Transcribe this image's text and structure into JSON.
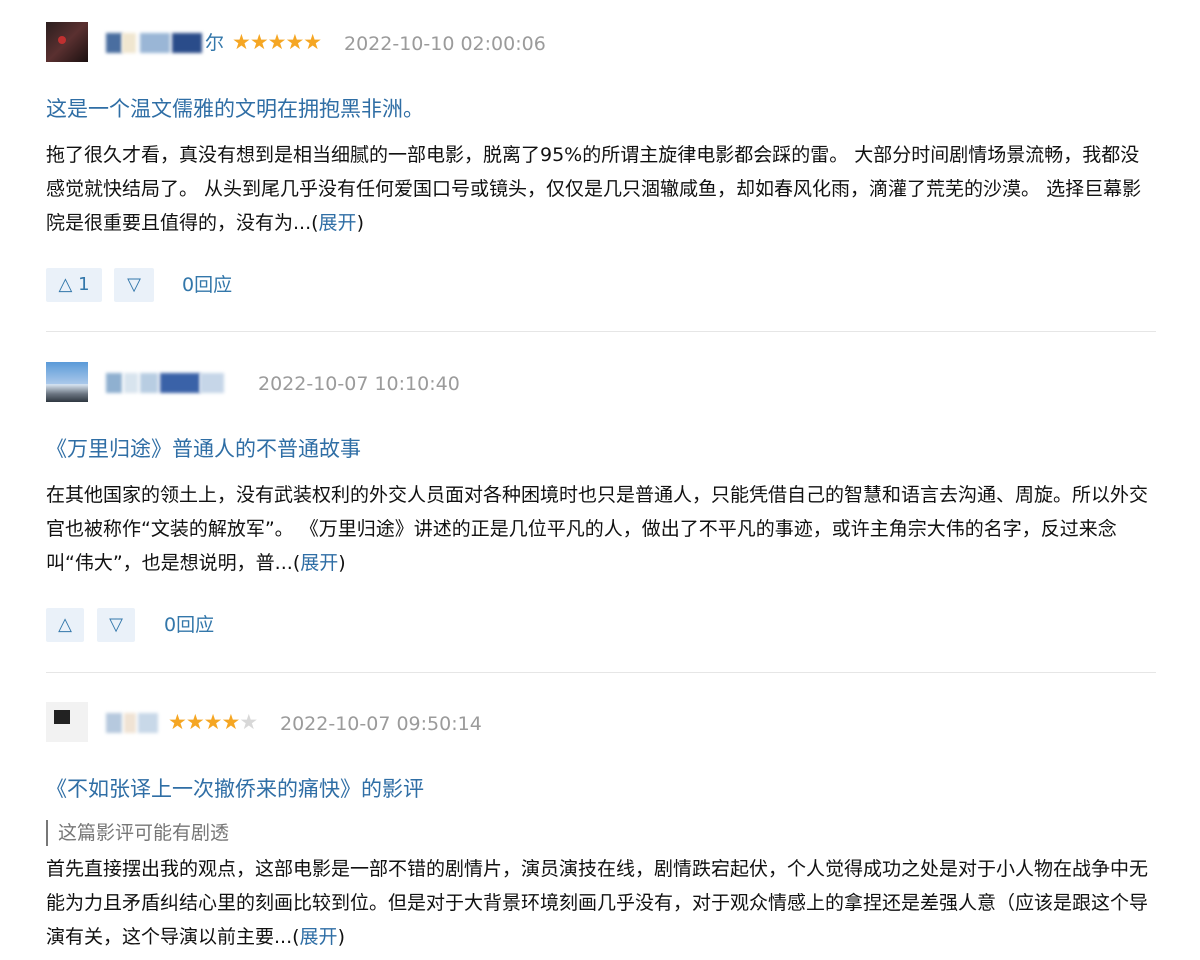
{
  "reviews": [
    {
      "username_visible": "尔",
      "stars": "★★★★★",
      "stars_off": "",
      "rating": 5,
      "date": "2022-10-10 02:00:06",
      "title": "这是一个温文儒雅的文明在拥抱黑非洲。",
      "spoiler": "",
      "body": "拖了很久才看，真没有想到是相当细腻的一部电影，脱离了95%的所谓主旋律电影都会踩的雷。 大部分时间剧情场景流畅，我都没感觉就快结局了。 从头到尾几乎没有任何爱国口号或镜头，仅仅是几只涸辙咸鱼，却如春风化雨，滴灌了荒芜的沙漠。 选择巨幕影院是很重要且值得的，没有为...",
      "expand_open": "(",
      "expand": "展开",
      "expand_close": ")",
      "up_arrow": "△",
      "up_count": "1",
      "down_arrow": "▽",
      "reply": "0回应"
    },
    {
      "username_visible": "",
      "stars": "",
      "stars_off": "",
      "rating": null,
      "date": "2022-10-07 10:10:40",
      "title": "《万里归途》普通人的不普通故事",
      "spoiler": "",
      "body": "在其他国家的领土上，没有武装权利的外交人员面对各种困境时也只是普通人，只能凭借自己的智慧和语言去沟通、周旋。所以外交官也被称作“文装的解放军”。 《万里归途》讲述的正是几位平凡的人，做出了不平凡的事迹，或许主角宗大伟的名字，反过来念叫“伟大”，也是想说明，普...",
      "expand_open": "(",
      "expand": "展开",
      "expand_close": ")",
      "up_arrow": "△",
      "up_count": "",
      "down_arrow": "▽",
      "reply": "0回应"
    },
    {
      "username_visible": "",
      "stars": "★★★★",
      "stars_off": "★",
      "rating": 4,
      "date": "2022-10-07 09:50:14",
      "title": "《不如张译上一次撤侨来的痛快》的影评",
      "spoiler": "这篇影评可能有剧透",
      "body": "首先直接摆出我的观点，这部电影是一部不错的剧情片，演员演技在线，剧情跌宕起伏，个人觉得成功之处是对于小人物在战争中无能为力且矛盾纠结心里的刻画比较到位。但是对于大背景环境刻画几乎没有，对于观众情感上的拿捏还是差强人意（应该是跟这个导演有关，这个导演以前主要...",
      "expand_open": "(",
      "expand": "展开",
      "expand_close": ")",
      "up_arrow": "",
      "up_count": "",
      "down_arrow": "",
      "reply": ""
    }
  ],
  "colors": {
    "link": "#2f6ea5",
    "username": "#3377aa",
    "star_on": "#f5a623",
    "star_off": "#d8d8d8",
    "date": "#9b9b9b",
    "vote_bg": "#eaf1f9"
  }
}
